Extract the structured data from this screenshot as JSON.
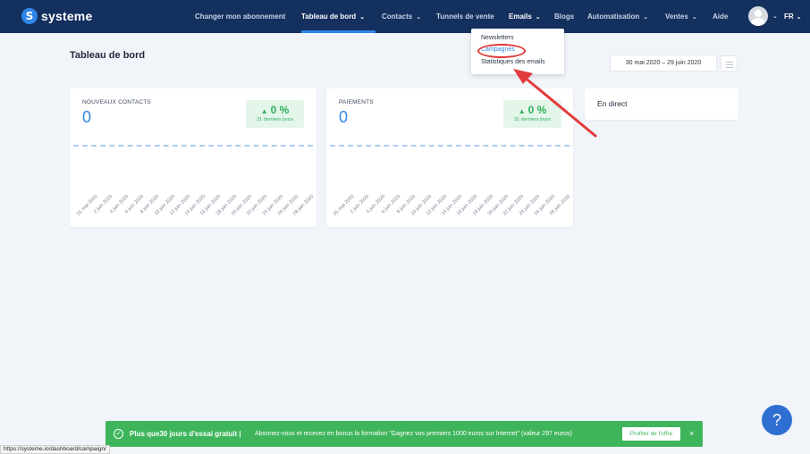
{
  "brand": {
    "name": "systeme",
    "logo_glyph": "S"
  },
  "nav": {
    "items": [
      {
        "label": "Changer mon abonnement"
      },
      {
        "label": "Tableau de bord",
        "dropdown": true,
        "active": true
      },
      {
        "label": "Contacts",
        "dropdown": true
      },
      {
        "label": "Tunnels de vente"
      },
      {
        "label": "Emails",
        "dropdown": true,
        "open": true
      },
      {
        "label": "Blogs"
      },
      {
        "label": "Automatisation",
        "dropdown": true
      },
      {
        "label": "Ventes",
        "dropdown": true
      },
      {
        "label": "Aide"
      }
    ],
    "language": "FR",
    "chevron_glyph": "⌄"
  },
  "emails_menu": {
    "items": [
      "Newsletters",
      "Campagnes",
      "Statistiques des emails"
    ],
    "highlighted": "Campagnes"
  },
  "page": {
    "title": "Tableau de bord",
    "date_range": "30 mai 2020  –  29 juin 2020"
  },
  "cards": {
    "contacts": {
      "label": "NOUVEAUX CONTACTS",
      "value": "0",
      "trend_glyph": "▲",
      "trend_pct": "0 %",
      "trend_note": "31 derniers jours"
    },
    "payments": {
      "label": "PAIEMENTS",
      "value": "0",
      "trend_glyph": "▲",
      "trend_pct": "0 %",
      "trend_note": "31 derniers jours"
    },
    "live": {
      "label": "En direct"
    }
  },
  "chart_ticks": [
    "31 mai 2020",
    "2 juin 2020",
    "4 juin 2020",
    "6 juin 2020",
    "8 juin 2020",
    "10 juin 2020",
    "12 juin 2020",
    "14 juin 2020",
    "16 juin 2020",
    "18 juin 2020",
    "20 juin 2020",
    "22 juin 2020",
    "24 juin 2020",
    "26 juin 2020",
    "28 juin 2020"
  ],
  "promo": {
    "icon_glyph": "✓",
    "main": "Plus que30 jours d'essai gratuit |",
    "sub": "Abonnez-vous et recevez en bonus la formation \"Gagnez vos premiers 1000 euros sur Internet\" (valeur 297 euros)",
    "button": "Profiter de l'offre",
    "close_glyph": "×"
  },
  "status_url": "https://systeme.io/dashboard/campaign/",
  "help_glyph": "?",
  "colors": {
    "nav_bg": "#14305e",
    "accent": "#2f86e6",
    "success": "#3fb55b",
    "annotation": "#e23b3b"
  }
}
